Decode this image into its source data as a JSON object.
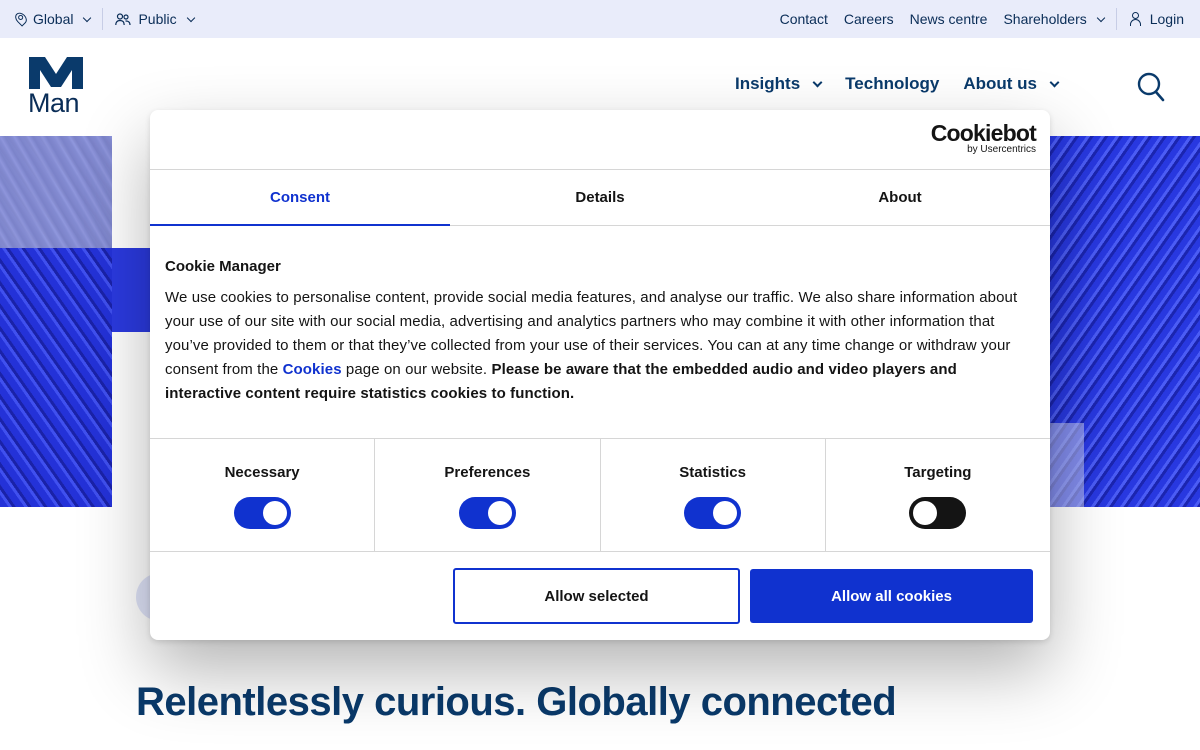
{
  "topbar": {
    "region": "Global",
    "audience": "Public",
    "links": [
      "Contact",
      "Careers",
      "News centre"
    ],
    "shareholders": "Shareholders",
    "login": "Login"
  },
  "header": {
    "logo_text": "Man",
    "nav": [
      "Insights",
      "Technology",
      "About us"
    ]
  },
  "hero": {
    "headline": "Relentlessly curious. Globally connected"
  },
  "cookie_dialog": {
    "brand": "Cookiebot",
    "brand_sub": "by Usercentrics",
    "tabs": [
      "Consent",
      "Details",
      "About"
    ],
    "active_tab": "Consent",
    "heading": "Cookie Manager",
    "text_1": "We use cookies to personalise content, provide social media features, and analyse our traffic. We also share information about your use of our site with our social media, advertising and analytics partners who may combine it with other information that you’ve provided to them or that they’ve collected from your use of their services. You can at any time change or withdraw your consent from the ",
    "link": "Cookies",
    "text_2": " page on our website. ",
    "text_bold": "Please be aware that the embedded audio and video players and interactive content require statistics cookies to function.",
    "toggles": [
      {
        "label": "Necessary",
        "on": true
      },
      {
        "label": "Preferences",
        "on": true
      },
      {
        "label": "Statistics",
        "on": true
      },
      {
        "label": "Targeting",
        "on": false
      }
    ],
    "buttons": {
      "allow_selected": "Allow selected",
      "allow_all": "Allow all cookies"
    }
  },
  "colors": {
    "accent": "#1032cf",
    "navy": "#0a3a6b",
    "topbar_bg": "#e9ecfa"
  }
}
